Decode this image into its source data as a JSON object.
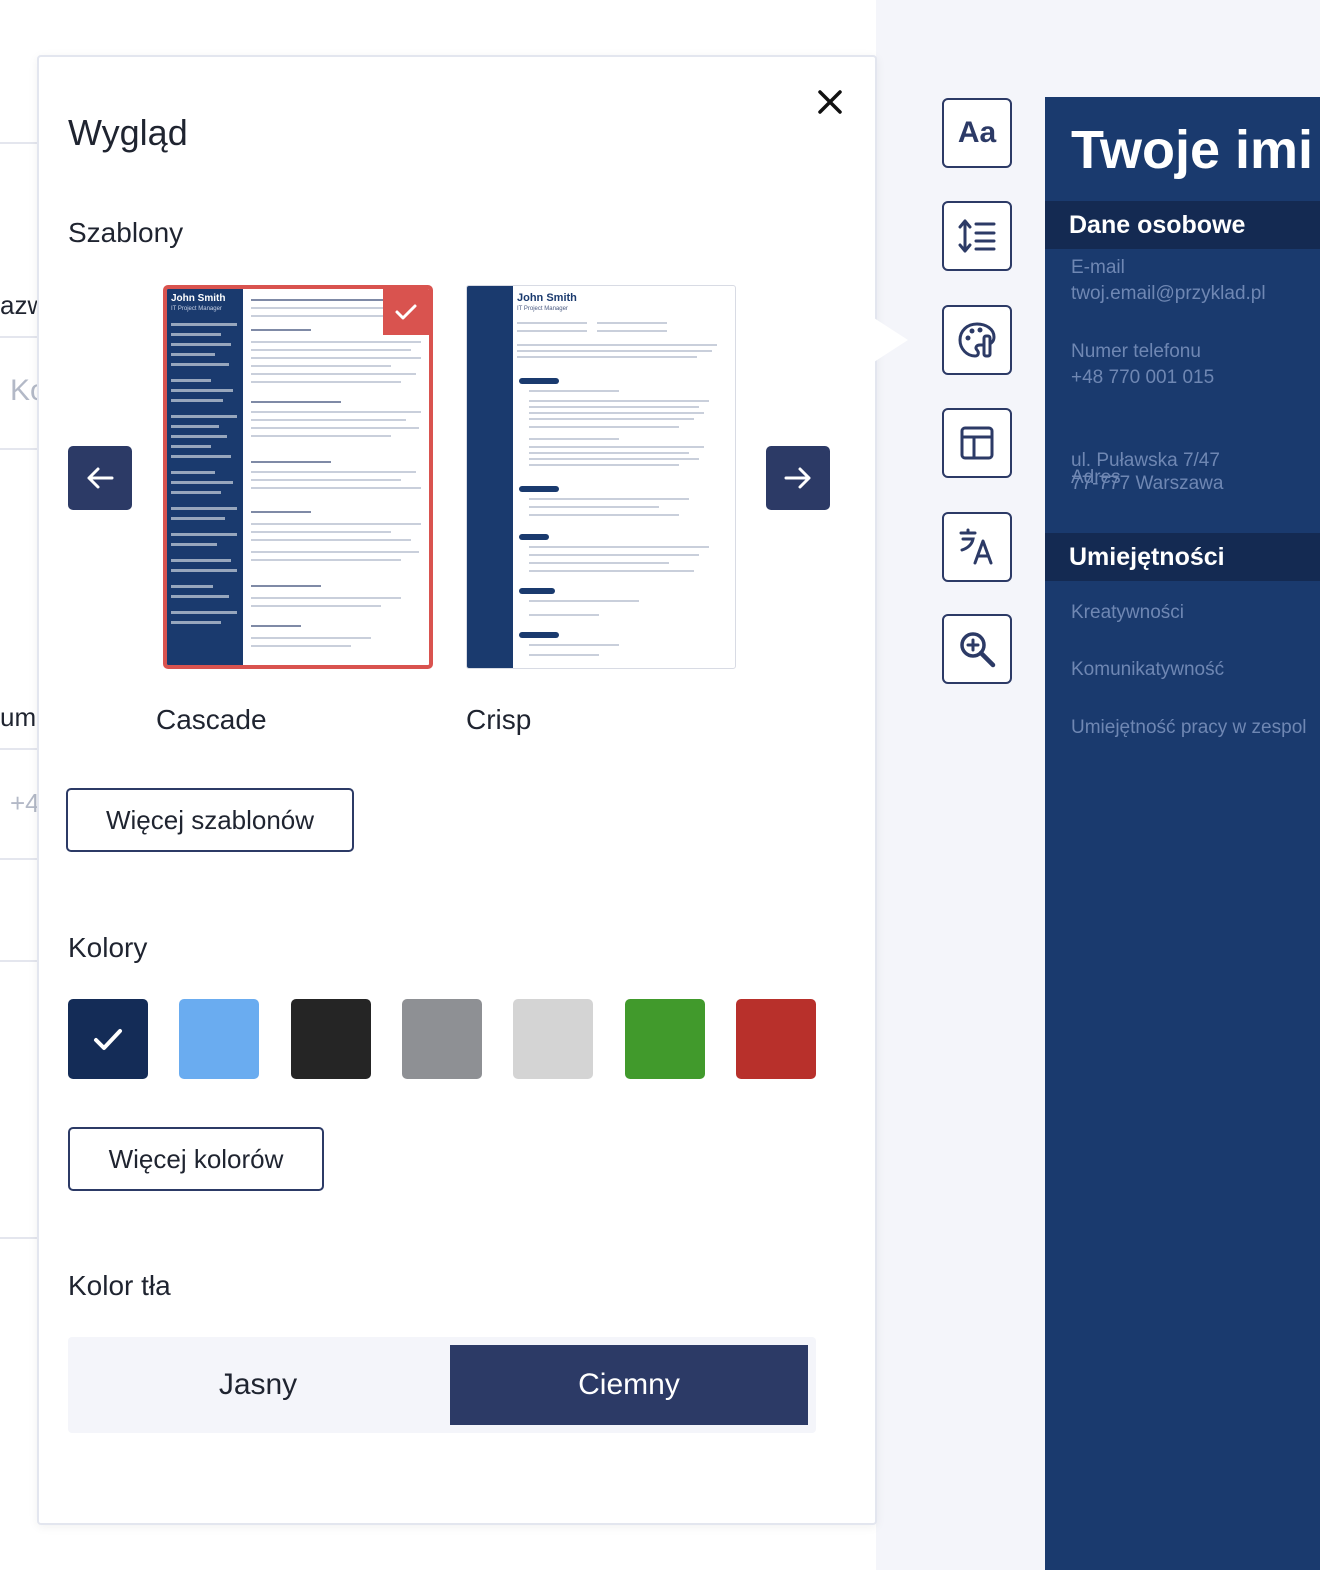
{
  "background_form": {
    "partial_texts": [
      "azw",
      "Ko",
      "ume",
      "+4"
    ]
  },
  "panel": {
    "title": "Wygląd",
    "close_icon": "close-icon",
    "templates": {
      "heading": "Szablony",
      "items": [
        {
          "name": "Cascade",
          "selected": true,
          "preview_name": "John Smith",
          "preview_subtitle": "IT Project Manager"
        },
        {
          "name": "Crisp",
          "selected": false,
          "preview_name": "John Smith",
          "preview_subtitle": "IT Project Manager"
        }
      ],
      "prev_icon": "arrow-left-icon",
      "next_icon": "arrow-right-icon",
      "more_button": "Więcej szablonów"
    },
    "colors": {
      "heading": "Kolory",
      "swatches": [
        "#142c57",
        "#6aacf0",
        "#252525",
        "#8e9094",
        "#d4d4d4",
        "#419a2c",
        "#b8302b"
      ],
      "selected_index": 0,
      "more_button": "Więcej kolorów"
    },
    "background": {
      "heading": "Kolor tła",
      "options": [
        "Jasny",
        "Ciemny"
      ],
      "selected": "Ciemny"
    }
  },
  "toolbar": {
    "tools": [
      "font-icon",
      "line-spacing-icon",
      "palette-icon",
      "layout-icon",
      "translate-icon",
      "zoom-in-icon"
    ]
  },
  "resume": {
    "name": "Twoje imi",
    "personal_heading": "Dane osobowe",
    "email_label": "E-mail",
    "email_value": "twoj.email@przyklad.pl",
    "phone_label": "Numer telefonu",
    "phone_value": "+48 770 001 015",
    "address_line1": "ul. Puławska 7/47",
    "address_label": "Adres",
    "address_line2": "77-777 Warszawa",
    "skills_heading": "Umiejętności",
    "skills": [
      "Kreatywności",
      "Komunikatywność",
      "Umiejętność pracy w zespol"
    ]
  }
}
